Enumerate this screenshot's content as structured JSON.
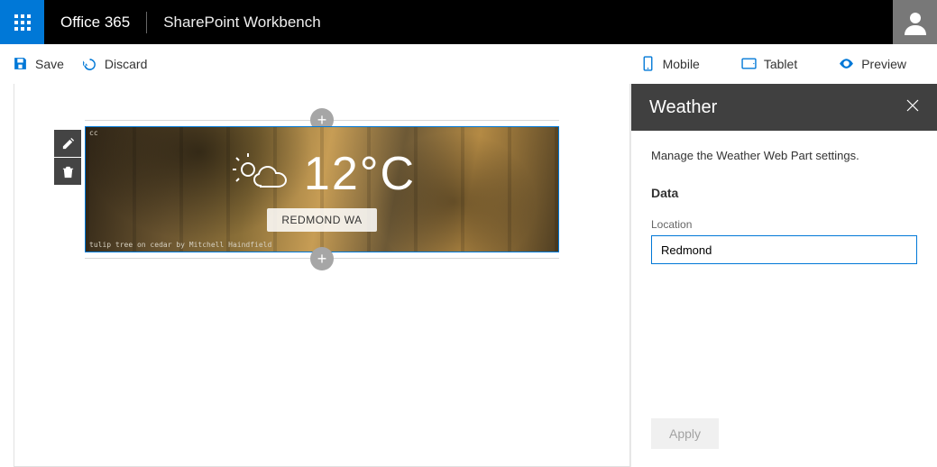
{
  "topbar": {
    "brand": "Office 365",
    "product": "SharePoint Workbench"
  },
  "commands": {
    "save": "Save",
    "discard": "Discard",
    "mobile": "Mobile",
    "tablet": "Tablet",
    "preview": "Preview"
  },
  "weather_part": {
    "temp_display": "12°C",
    "location_display": "REDMOND WA",
    "cc_label": "cc",
    "credit": "tulip tree on cedar by Mitchell Haindfield"
  },
  "pane": {
    "title": "Weather",
    "description": "Manage the Weather Web Part settings.",
    "group_title": "Data",
    "location_label": "Location",
    "location_value": "Redmond",
    "apply": "Apply"
  }
}
